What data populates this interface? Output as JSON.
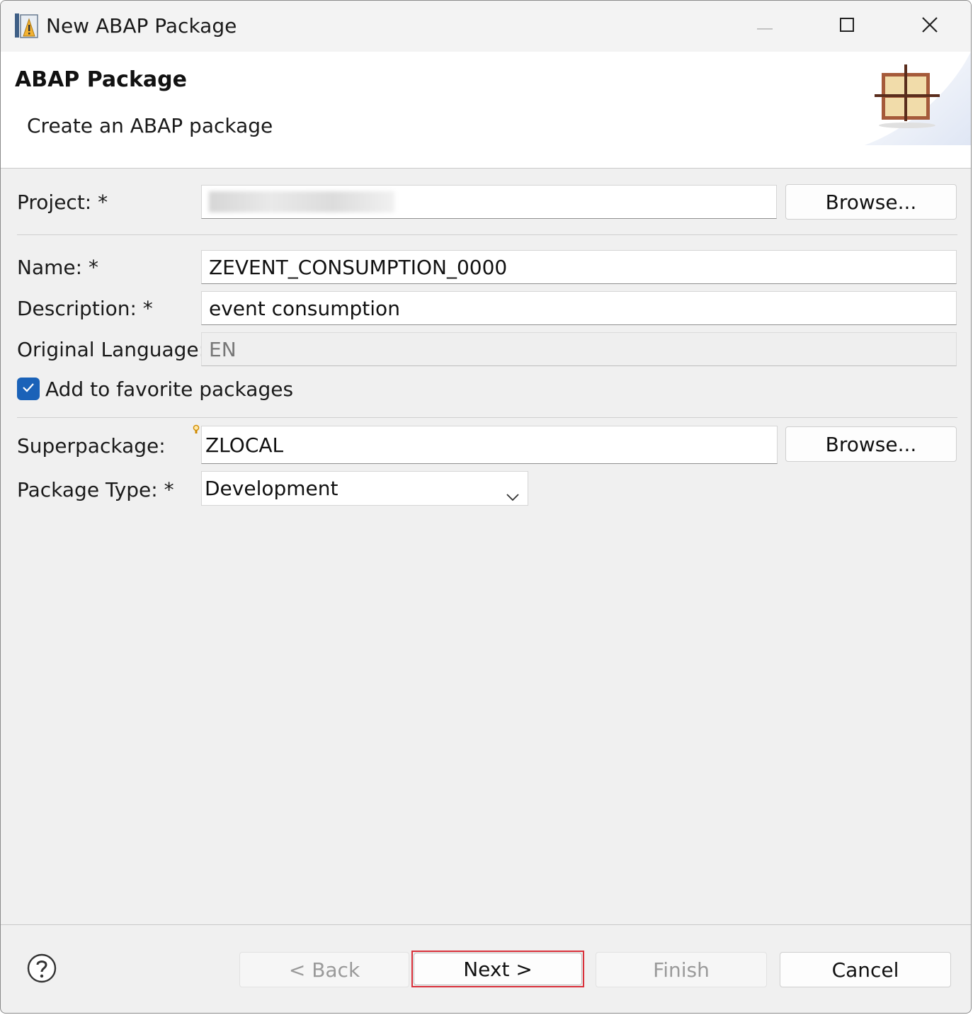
{
  "window": {
    "title": "New ABAP Package"
  },
  "header": {
    "title": "ABAP Package",
    "description": "Create an ABAP package"
  },
  "form": {
    "project": {
      "label": "Project: *",
      "value": "",
      "browse_label": "Browse..."
    },
    "name": {
      "label": "Name: *",
      "value": "ZEVENT_CONSUMPTION_0000"
    },
    "description": {
      "label": "Description: *",
      "value": "event consumption"
    },
    "original_language": {
      "label": "Original Language:",
      "value": "EN"
    },
    "favorite": {
      "label": "Add to favorite packages",
      "checked": true
    },
    "superpackage": {
      "label": "Superpackage:",
      "value": "ZLOCAL",
      "browse_label": "Browse..."
    },
    "package_type": {
      "label": "Package Type: *",
      "value": "Development"
    }
  },
  "footer": {
    "back_label": "< Back",
    "next_label": "Next >",
    "finish_label": "Finish",
    "cancel_label": "Cancel"
  },
  "colors": {
    "checkbox": "#1a62b8",
    "highlight": "#d9303a"
  }
}
